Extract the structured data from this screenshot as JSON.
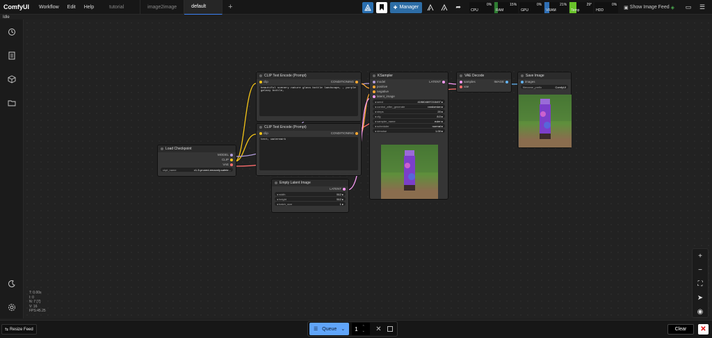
{
  "app": {
    "name": "ComfyUI",
    "status": "Idle"
  },
  "menu": [
    "Workflow",
    "Edit",
    "Help"
  ],
  "tabs": [
    {
      "label": "tutorial",
      "active": false
    },
    {
      "label": "image2image",
      "active": false
    },
    {
      "label": "default",
      "active": true
    }
  ],
  "toolbar": {
    "manager_label": "Manager",
    "show_feed_label": "Show Image Feed",
    "monitors": [
      {
        "label": "CPU",
        "value": "0%",
        "level": 0,
        "color": "#2e7d32"
      },
      {
        "label": "RAM",
        "value": "15%",
        "level": 15,
        "color": "#2e7d32"
      },
      {
        "label": "GPU",
        "value": "0%",
        "level": 0,
        "color": "#2e7d32"
      },
      {
        "label": "VRAM",
        "value": "21%",
        "level": 21,
        "color": "#2f6fb5"
      },
      {
        "label": "Temp",
        "value": "29°",
        "level": 29,
        "color": "#69c22a"
      },
      {
        "label": "HDD",
        "value": "0%",
        "level": 0,
        "color": "#2e7d32"
      }
    ]
  },
  "stats": [
    "T: 0.00s",
    "I: 0",
    "N: 7 [7]",
    "V: 16",
    "FPS:45.25"
  ],
  "nodes": {
    "load_checkpoint": {
      "title": "Load Checkpoint",
      "outputs": [
        "MODEL",
        "CLIP",
        "VAE"
      ],
      "ckpt_label": "ckpt_name",
      "ckpt_value": "v1-5-pruned-emaonly.safete..."
    },
    "clip_pos": {
      "title": "CLIP Text Encode (Prompt)",
      "input": "clip",
      "output": "CONDITIONING",
      "text": "beautiful scenery nature glass bottle landscape, , purple galaxy bottle,"
    },
    "clip_neg": {
      "title": "CLIP Text Encode (Prompt)",
      "input": "clip",
      "output": "CONDITIONING",
      "text": "text, watermark"
    },
    "empty_latent": {
      "title": "Empty Latent Image",
      "output": "LATENT",
      "widgets": [
        {
          "label": "width",
          "value": "512"
        },
        {
          "label": "height",
          "value": "512"
        },
        {
          "label": "batch_size",
          "value": "1"
        }
      ]
    },
    "ksampler": {
      "title": "KSampler",
      "inputs": [
        "model",
        "positive",
        "negative",
        "latent_image"
      ],
      "output": "LATENT",
      "widgets": [
        {
          "label": "seed",
          "value": "419804697215497"
        },
        {
          "label": "control_after_generate",
          "value": "randomize"
        },
        {
          "label": "steps",
          "value": "20"
        },
        {
          "label": "cfg",
          "value": "8.0"
        },
        {
          "label": "sampler_name",
          "value": "euler"
        },
        {
          "label": "scheduler",
          "value": "normal"
        },
        {
          "label": "denoise",
          "value": "1.00"
        }
      ]
    },
    "vae_decode": {
      "title": "VAE Decode",
      "inputs": [
        "samples",
        "vae"
      ],
      "output": "IMAGE"
    },
    "save_image": {
      "title": "Save Image",
      "input": "images",
      "prefix_label": "filename_prefix",
      "prefix_value": "ComfyUI"
    }
  },
  "bottom": {
    "resize_label": "Resize Feed",
    "queue_label": "Queue",
    "queue_count": "1",
    "clear_label": "Clear"
  }
}
